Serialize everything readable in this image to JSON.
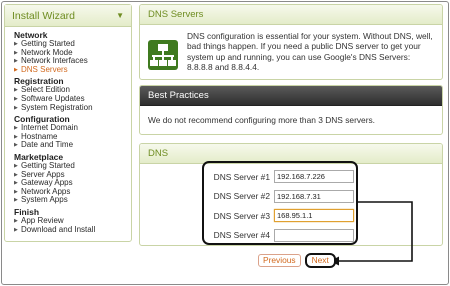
{
  "sidebar": {
    "title": "Install Wizard",
    "caret": "▼",
    "sections": [
      {
        "label": "Network",
        "items": [
          "Getting Started",
          "Network Mode",
          "Network Interfaces",
          "DNS Servers"
        ]
      },
      {
        "label": "Registration",
        "items": [
          "Select Edition",
          "Software Updates",
          "System Registration"
        ]
      },
      {
        "label": "Configuration",
        "items": [
          "Internet Domain",
          "Hostname",
          "Date and Time"
        ]
      },
      {
        "label": "Marketplace",
        "items": [
          "Getting Started",
          "Server Apps",
          "Gateway Apps",
          "Network Apps",
          "System Apps"
        ]
      },
      {
        "label": "Finish",
        "items": [
          "App Review",
          "Download and Install"
        ]
      }
    ],
    "current_item": "DNS Servers"
  },
  "dns_panel": {
    "title": "DNS Servers",
    "description": "DNS configuration is essential for your system. Without DNS, well, bad things happen. If you need a public DNS server to get your system up and running, you can use Google's DNS Servers: 8.8.8.8 and 8.8.4.4."
  },
  "best_practices": {
    "title": "Best Practices",
    "text": "We do not recommend configuring more than 3 DNS servers."
  },
  "dns_form": {
    "title": "DNS",
    "fields": [
      {
        "label": "DNS Server #1",
        "value": "192.168.7.226"
      },
      {
        "label": "DNS Server #2",
        "value": "192.168.7.31"
      },
      {
        "label": "DNS Server #3",
        "value": "168.95.1.1"
      },
      {
        "label": "DNS Server #4",
        "value": ""
      }
    ]
  },
  "nav_buttons": {
    "previous": "Previous",
    "next": "Next"
  },
  "colors": {
    "accent_green": "#6f8d22",
    "current_orange": "#d2691e",
    "icon_green": "#3f7a1f",
    "callout": "#111111"
  },
  "icons": [
    "chevron-down-icon",
    "bullet-icon",
    "dns-network-icon",
    "arrow-icon"
  ]
}
